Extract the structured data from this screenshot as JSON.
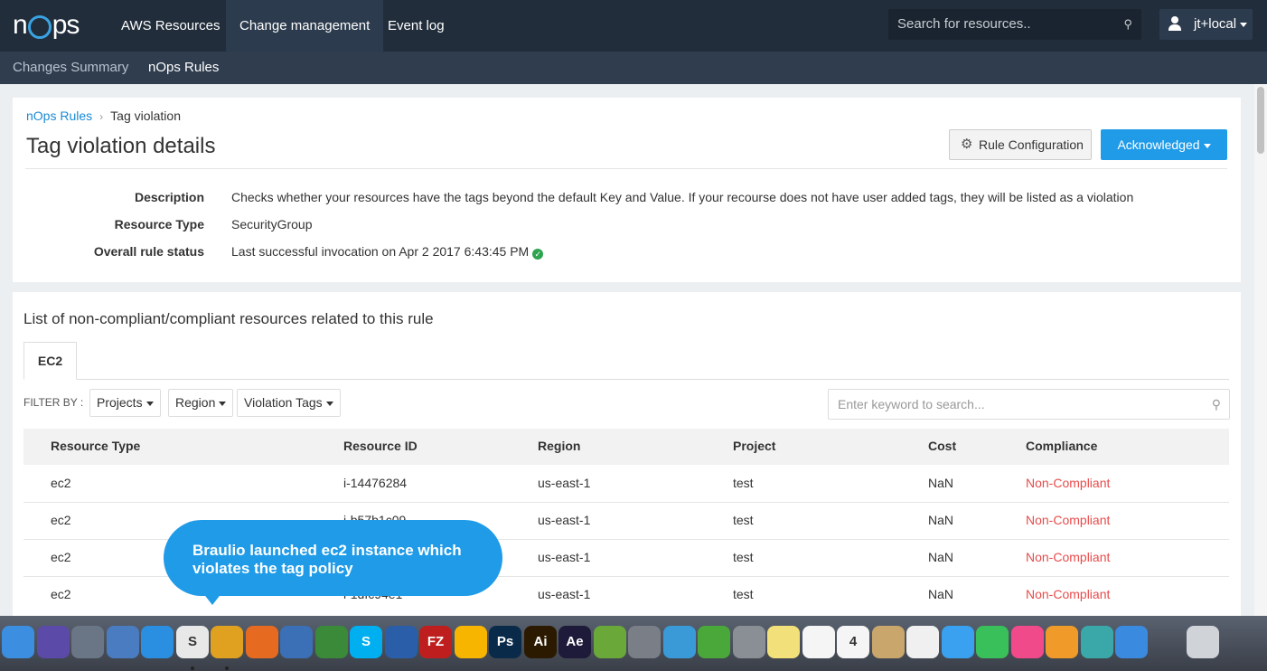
{
  "app": {
    "logo_text_left": "n",
    "logo_text_right": "ps"
  },
  "topnav": {
    "items": [
      {
        "label": "AWS Resources"
      },
      {
        "label": "Change management"
      },
      {
        "label": "Event log"
      }
    ],
    "search_placeholder": "Search for resources..",
    "user": "jt+local"
  },
  "subnav": {
    "items": [
      {
        "label": "Changes Summary"
      },
      {
        "label": "nOps Rules"
      }
    ]
  },
  "breadcrumb": {
    "parent": "nOps Rules",
    "current": "Tag violation"
  },
  "page_title": "Tag violation details",
  "buttons": {
    "config": "Rule Configuration",
    "ack": "Acknowledged"
  },
  "details": {
    "description_label": "Description",
    "description": "Checks whether your resources have the tags beyond the default Key and Value. If your recourse does not have user added tags, they will be listed as a violation",
    "resource_type_label": "Resource Type",
    "resource_type": "SecurityGroup",
    "status_label": "Overall rule status",
    "status": "Last successful invocation on Apr 2 2017 6:43:45 PM"
  },
  "list": {
    "title": "List of non-compliant/compliant resources related to this rule",
    "tab": "EC2",
    "filter_label": "FILTER BY :",
    "filters": [
      "Projects",
      "Region",
      "Violation Tags"
    ],
    "search_placeholder": "Enter keyword to search..."
  },
  "table": {
    "columns": [
      "Resource Type",
      "Resource ID",
      "Region",
      "Project",
      "Cost",
      "Compliance"
    ],
    "rows": [
      [
        "ec2",
        "i-14476284",
        "us-east-1",
        "test",
        "NaN",
        "Non-Compliant"
      ],
      [
        "ec2",
        "i-b57b1c09",
        "us-east-1",
        "test",
        "NaN",
        "Non-Compliant"
      ],
      [
        "ec2",
        "",
        "us-east-1",
        "test",
        "NaN",
        "Non-Compliant"
      ],
      [
        "ec2",
        "i-1dfc94e1",
        "us-east-1",
        "test",
        "NaN",
        "Non-Compliant"
      ]
    ]
  },
  "callout": {
    "text": "Braulio launched ec2 instance which violates the tag policy"
  },
  "colors": {
    "accent": "#1f9be8",
    "nav": "#212d3b",
    "danger": "#e84c4c"
  },
  "dock": {
    "icons": [
      {
        "name": "finder-icon",
        "color": "#3c8ee0"
      },
      {
        "name": "siri-icon",
        "color": "#5b4aa8"
      },
      {
        "name": "launchpad-icon",
        "color": "#6a7585"
      },
      {
        "name": "mail-icon",
        "color": "#4a7cc2"
      },
      {
        "name": "safari-icon",
        "color": "#2a8fe0"
      },
      {
        "name": "slack-icon",
        "color": "#e8e8e8",
        "text": "S"
      },
      {
        "name": "chrome-icon",
        "color": "#e0a020"
      },
      {
        "name": "firefox-icon",
        "color": "#e66a1f"
      },
      {
        "name": "thunderbird-icon",
        "color": "#3b6fb6"
      },
      {
        "name": "evernote-icon",
        "color": "#3a8a3a"
      },
      {
        "name": "skype-icon",
        "color": "#00aff0",
        "text": "S"
      },
      {
        "name": "sourcetree-icon",
        "color": "#2a5ea8"
      },
      {
        "name": "filezilla-icon",
        "color": "#bf1e1e",
        "text": "FZ"
      },
      {
        "name": "sketch-icon",
        "color": "#f7b500"
      },
      {
        "name": "photoshop-icon",
        "color": "#0a2a4a",
        "text": "Ps"
      },
      {
        "name": "illustrator-icon",
        "color": "#2b1a00",
        "text": "Ai"
      },
      {
        "name": "aftereffects-icon",
        "color": "#1e1a3a",
        "text": "Ae"
      },
      {
        "name": "bluestacks-icon",
        "color": "#6aa83a"
      },
      {
        "name": "system-prefs-icon",
        "color": "#7a7f87"
      },
      {
        "name": "migration-icon",
        "color": "#3a9ad8"
      },
      {
        "name": "utorrent-icon",
        "color": "#4aa83a"
      },
      {
        "name": "sequel-icon",
        "color": "#8a8f96"
      },
      {
        "name": "notes-icon",
        "color": "#f2e07a"
      },
      {
        "name": "reminders-icon",
        "color": "#f5f5f5"
      },
      {
        "name": "calendar-icon",
        "color": "#f5f5f5",
        "text": "4"
      },
      {
        "name": "preview-icon",
        "color": "#c9a66b"
      },
      {
        "name": "photos-icon",
        "color": "#f0f0f0"
      },
      {
        "name": "messages-icon",
        "color": "#3aa0f0"
      },
      {
        "name": "facetime-icon",
        "color": "#3ac05a"
      },
      {
        "name": "itunes-icon",
        "color": "#f04a8a"
      },
      {
        "name": "ibooks-icon",
        "color": "#f09a2a"
      },
      {
        "name": "vpn-icon",
        "color": "#3aa8a8"
      },
      {
        "name": "appstore-icon",
        "color": "#3a8ae0"
      },
      {
        "name": "trash-icon",
        "color": "#d0d4d8"
      }
    ]
  }
}
